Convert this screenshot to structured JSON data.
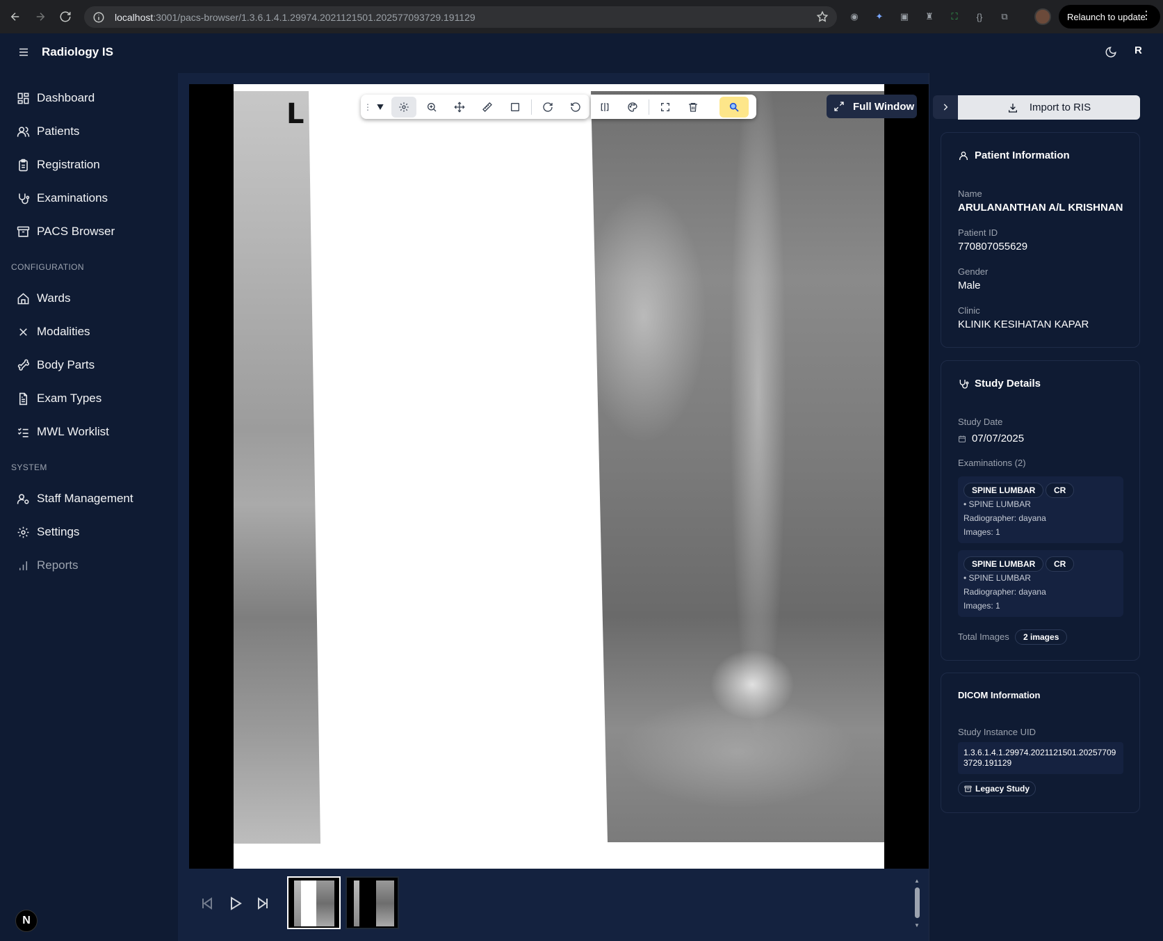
{
  "browser": {
    "url_host": "localhost",
    "url_rest": ":3001/pacs-browser/1.3.6.1.4.1.29974.2021121501.202577093729.191129",
    "relaunch_label": "Relaunch to update"
  },
  "app": {
    "brand": "Radiology IS",
    "avatar_initial": "R"
  },
  "sidebar": {
    "items": [
      {
        "label": "Dashboard"
      },
      {
        "label": "Patients"
      },
      {
        "label": "Registration"
      },
      {
        "label": "Examinations"
      },
      {
        "label": "PACS Browser"
      }
    ],
    "config_label": "CONFIGURATION",
    "config_items": [
      {
        "label": "Wards"
      },
      {
        "label": "Modalities"
      },
      {
        "label": "Body Parts"
      },
      {
        "label": "Exam Types"
      },
      {
        "label": "MWL Worklist"
      }
    ],
    "system_label": "SYSTEM",
    "system_items": [
      {
        "label": "Staff Management"
      },
      {
        "label": "Settings"
      },
      {
        "label": "Reports"
      }
    ],
    "n_badge": "N"
  },
  "viewer": {
    "laterality_marker": "L",
    "full_window_label": "Full Window"
  },
  "panel": {
    "import_label": "Import to RIS",
    "patient": {
      "title": "Patient Information",
      "name_label": "Name",
      "name": "ARULANANTHAN A/L KRISHNAN",
      "id_label": "Patient ID",
      "id": "770807055629",
      "gender_label": "Gender",
      "gender": "Male",
      "clinic_label": "Clinic",
      "clinic": "KLINIK KESIHATAN KAPAR"
    },
    "study": {
      "title": "Study Details",
      "date_label": "Study Date",
      "date": "07/07/2025",
      "exams_label": "Examinations (2)",
      "exams": [
        {
          "name": "SPINE LUMBAR",
          "modality": "CR",
          "body_part": "• SPINE LUMBAR",
          "radiographer": "Radiographer: dayana",
          "images": "Images: 1"
        },
        {
          "name": "SPINE LUMBAR",
          "modality": "CR",
          "body_part": "• SPINE LUMBAR",
          "radiographer": "Radiographer: dayana",
          "images": "Images: 1"
        }
      ],
      "total_label": "Total Images",
      "total_value": "2 images"
    },
    "dicom": {
      "title": "DICOM Information",
      "uid_label": "Study Instance UID",
      "uid": "1.3.6.1.4.1.29974.2021121501.202577093729.191129",
      "legacy_label": "Legacy Study"
    }
  }
}
